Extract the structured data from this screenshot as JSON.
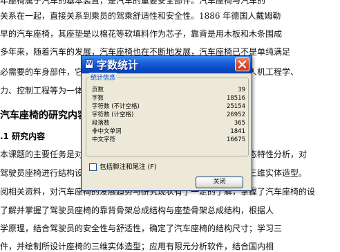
{
  "document": {
    "lines": [
      "年座椅属于汽车的基本装置，是汽车的重要安全部件。汽车座椅与汽车的",
      "关系在一起，直接关系到乘员的驾乘舒适性和安全性。1886 年德国人戴姆勒",
      "早的汽车座椅，其座垫是以棉花等软填料作为芯子，靠背是用木板和木条围成",
      "多年来，随着汽车的发展，汽车座椅也在不断地发展，汽车座椅已不是单纯满足",
      "必需要的车身部件，它已成为涉及人体工程学、安全性、舒适性，集人机工程学、",
      "力、控制工程等为一体的工程产品。",
      "汽车座椅的研究内容",
      ".1 研究内容",
      "本课题的主要任务是对汽车驾驶员座椅进行结构设计及座椅骨架的静态特性分析，对",
      "驾驶员座椅进行结构设计，包括靠背骨架和座垫骨架，并进行座椅的三维实体造型。",
      "阅相关资料，对汽车座椅的发展趋势与研究现状有了一定的了解，掌握了汽车座椅的设",
      "   了解并掌握了驾驶员座椅的靠背骨架总成结构与座垫骨架总成结构，根据人",
      "学原理，结合驾驶员的安全性与舒适性，确定了汽车座椅的结构尺寸；学习三",
      "件，并绘制所设计座椅的三维实体造型；应用有限元分析软件，结合国内相"
    ]
  },
  "dialog": {
    "title": "字数统计",
    "title_icon_letter": "W",
    "group_title": "统计信息",
    "stats": [
      {
        "label": "页数",
        "value": "39"
      },
      {
        "label": "字数",
        "value": "18516"
      },
      {
        "label": "字符数 (不计空格)",
        "value": "25154"
      },
      {
        "label": "字符数 (计空格)",
        "value": "26952"
      },
      {
        "label": "段落数",
        "value": "365"
      },
      {
        "label": "非中文单词",
        "value": "1841"
      },
      {
        "label": "中文字符",
        "value": "16675"
      }
    ],
    "checkbox_label": "包括脚注和尾注 (F)",
    "checkbox_checked": false,
    "close_button_label": "关闭",
    "close_icon": "close-x-icon",
    "colors": {
      "titlebar": "#0a48c4",
      "close_button": "#d45036",
      "dialog_bg": "#ece9d8",
      "group_title": "#0046d5"
    }
  }
}
